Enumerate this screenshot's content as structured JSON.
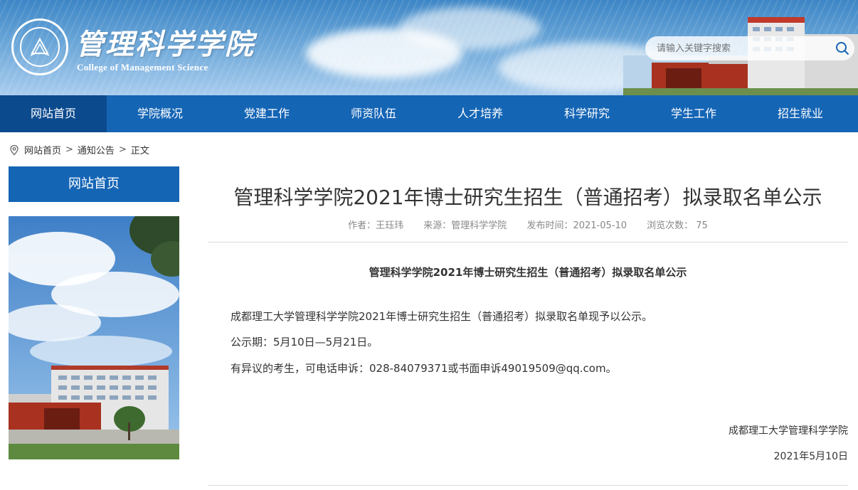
{
  "header": {
    "logo_title": "管理科学学院",
    "logo_subtitle": "College of Management Science",
    "search_placeholder": "请输入关键字搜索"
  },
  "nav": {
    "items": [
      "网站首页",
      "学院概况",
      "党建工作",
      "师资队伍",
      "人才培养",
      "科学研究",
      "学生工作",
      "招生就业"
    ],
    "active_index": 0
  },
  "breadcrumb": {
    "items": [
      "网站首页",
      "通知公告",
      "正文"
    ],
    "separator": ">"
  },
  "sidebar": {
    "heading": "网站首页"
  },
  "article": {
    "title": "管理科学学院2021年博士研究生招生（普通招考）拟录取名单公示",
    "meta": {
      "author": "作者：王珏玮",
      "source": "来源：管理科学学院",
      "date": "发布时间：2021-05-10",
      "views": "浏览次数：  75"
    },
    "subtitle": "管理科学学院2021年博士研究生招生（普通招考）拟录取名单公示",
    "paragraphs": [
      "成都理工大学管理科学学院2021年博士研究生招生（普通招考）拟录取名单现予以公示。",
      "公示期：5月10日—5月21日。",
      "有异议的考生，可电话申诉：028-84079371或书面申诉49019509@qq.com。"
    ],
    "signature_org": "成都理工大学管理科学学院",
    "signature_date": "2021年5月10日"
  },
  "colors": {
    "nav_bg": "#1565b5",
    "nav_active": "#0c4a8e",
    "text": "#333333",
    "meta": "#888888"
  },
  "icons": [
    "location-pin-icon",
    "search-icon",
    "college-seal-logo"
  ]
}
